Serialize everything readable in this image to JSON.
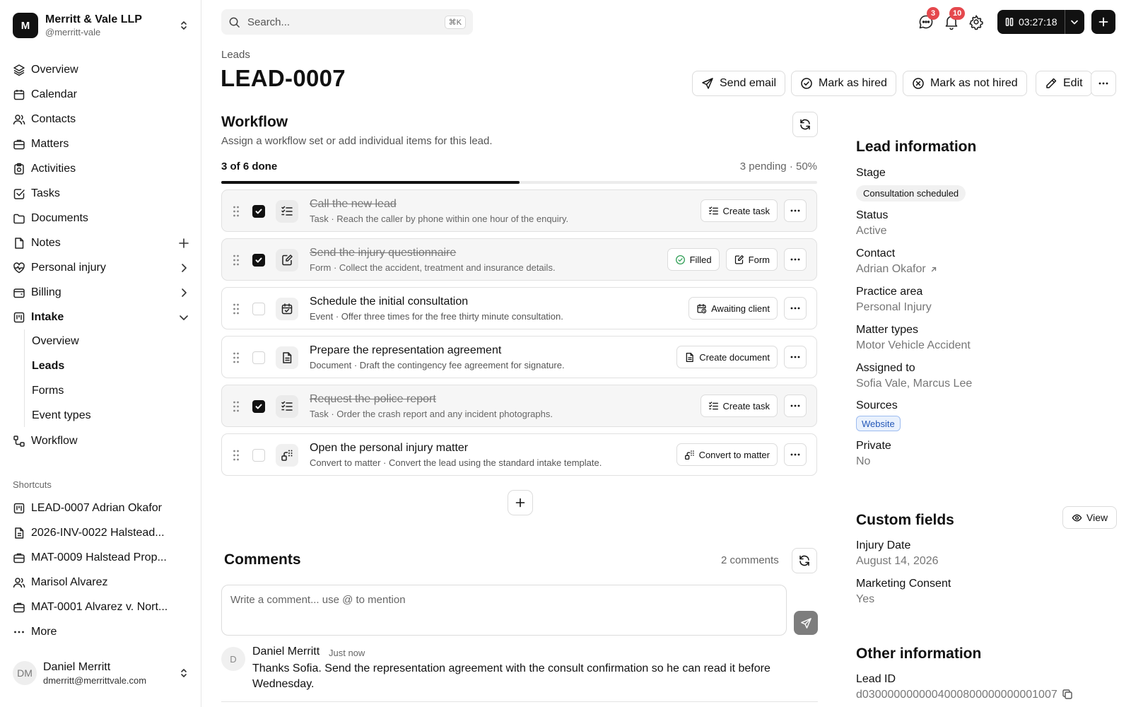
{
  "org": {
    "logo_letter": "M",
    "name": "Merritt & Vale LLP",
    "handle": "@merritt-vale"
  },
  "sidebar": {
    "items": [
      {
        "label": "Overview",
        "icon": "layers-icon"
      },
      {
        "label": "Calendar",
        "icon": "calendar-icon"
      },
      {
        "label": "Contacts",
        "icon": "users-icon"
      },
      {
        "label": "Matters",
        "icon": "briefcase-icon"
      },
      {
        "label": "Activities",
        "icon": "clipboard-icon"
      },
      {
        "label": "Tasks",
        "icon": "check-square-icon"
      },
      {
        "label": "Documents",
        "icon": "folder-icon"
      },
      {
        "label": "Notes",
        "icon": "file-icon",
        "trailing": "plus-icon"
      },
      {
        "label": "Personal injury",
        "icon": "heart-icon",
        "trailing": "chevron-right-icon"
      },
      {
        "label": "Billing",
        "icon": "wallet-icon",
        "trailing": "chevron-right-icon"
      },
      {
        "label": "Intake",
        "icon": "kanban-icon",
        "trailing": "chevron-down-icon",
        "expanded": true
      },
      {
        "label": "Workflow",
        "icon": "workflow-icon"
      }
    ],
    "intake_sub": [
      {
        "label": "Overview",
        "active": false
      },
      {
        "label": "Leads",
        "active": true
      },
      {
        "label": "Forms",
        "active": false
      },
      {
        "label": "Event types",
        "active": false
      }
    ],
    "shortcuts_label": "Shortcuts",
    "shortcuts": [
      {
        "label": "LEAD-0007 Adrian Okafor",
        "icon": "kanban-icon"
      },
      {
        "label": "2026-INV-0022 Halstead...",
        "icon": "file-icon"
      },
      {
        "label": "MAT-0009 Halstead Prop...",
        "icon": "briefcase-icon"
      },
      {
        "label": "Marisol Alvarez",
        "icon": "users-icon"
      },
      {
        "label": "MAT-0001 Alvarez v. Nort...",
        "icon": "briefcase-icon"
      }
    ],
    "more_label": "More"
  },
  "user": {
    "initials": "DM",
    "name": "Daniel Merritt",
    "email": "dmerritt@merrittvale.com"
  },
  "search": {
    "placeholder": "Search...",
    "shortcut": "⌘K"
  },
  "topbar": {
    "messages_badge": "3",
    "notifications_badge": "10",
    "timer": "03:27:18"
  },
  "header": {
    "breadcrumb": "Leads",
    "title": "LEAD-0007",
    "actions": {
      "send_email": "Send email",
      "mark_hired": "Mark as hired",
      "mark_not_hired": "Mark as not hired",
      "edit": "Edit"
    }
  },
  "workflow": {
    "title": "Workflow",
    "subtitle": "Assign a workflow set or add individual items for this lead.",
    "progress_text": "3 of 6 done",
    "pending_text": "3 pending · 50%",
    "progress_fraction": 0.5,
    "items": [
      {
        "done": true,
        "icon": "task-list-icon",
        "name": "Call the new lead",
        "desc": "Task · Reach the caller by phone within one hour of the enquiry.",
        "chips": [
          {
            "label": "Create task",
            "icon": "task-list-icon",
            "name": "create-task-button"
          }
        ]
      },
      {
        "done": true,
        "icon": "form-edit-icon",
        "name": "Send the injury questionnaire",
        "desc": "Form · Collect the accident, treatment and insurance details.",
        "chips": [
          {
            "label": "Filled",
            "icon": "check-circle-icon",
            "name": "filled-status-button",
            "green": true
          },
          {
            "label": "Form",
            "icon": "form-edit-icon",
            "name": "form-button"
          }
        ]
      },
      {
        "done": false,
        "icon": "calendar-check-icon",
        "name": "Schedule the initial consultation",
        "desc": "Event · Offer three times for the free thirty minute consultation.",
        "chips": [
          {
            "label": "Awaiting client",
            "icon": "calendar-clock-icon",
            "name": "awaiting-client-button"
          }
        ]
      },
      {
        "done": false,
        "icon": "document-icon",
        "name": "Prepare the representation agreement",
        "desc": "Document · Draft the contingency fee agreement for signature.",
        "chips": [
          {
            "label": "Create document",
            "icon": "document-icon",
            "name": "create-document-button"
          }
        ]
      },
      {
        "done": true,
        "icon": "task-list-icon",
        "name": "Request the police report",
        "desc": "Task · Order the crash report and any incident photographs.",
        "chips": [
          {
            "label": "Create task",
            "icon": "task-list-icon",
            "name": "create-task-button"
          }
        ]
      },
      {
        "done": false,
        "icon": "convert-icon",
        "name": "Open the personal injury matter",
        "desc": "Convert to matter · Convert the lead using the standard intake template.",
        "chips": [
          {
            "label": "Convert to matter",
            "icon": "convert-icon",
            "name": "convert-to-matter-button"
          }
        ]
      }
    ]
  },
  "comments": {
    "title": "Comments",
    "count_text": "2 comments",
    "placeholder": "Write a comment... use @ to mention",
    "items": [
      {
        "avatar": "D",
        "author": "Daniel Merritt",
        "time": "Just now",
        "text": "Thanks Sofia. Send the representation agreement with the consult confirmation so he can read it before Wednesday."
      }
    ]
  },
  "lead_info": {
    "title": "Lead information",
    "stage_label": "Stage",
    "stage": "Consultation scheduled",
    "status_label": "Status",
    "status": "Active",
    "contact_label": "Contact",
    "contact": "Adrian Okafor",
    "practice_label": "Practice area",
    "practice": "Personal Injury",
    "matter_types_label": "Matter types",
    "matter_types": "Motor Vehicle Accident",
    "assigned_label": "Assigned to",
    "assigned": "Sofia Vale, Marcus Lee",
    "sources_label": "Sources",
    "source": "Website",
    "private_label": "Private",
    "private": "No"
  },
  "custom_fields": {
    "title": "Custom fields",
    "view_label": "View",
    "injury_date_label": "Injury Date",
    "injury_date": "August 14, 2026",
    "marketing_label": "Marketing Consent",
    "marketing": "Yes"
  },
  "other_info": {
    "title": "Other information",
    "lead_id_label": "Lead ID",
    "lead_id": "d0300000000004000800000000001007"
  }
}
